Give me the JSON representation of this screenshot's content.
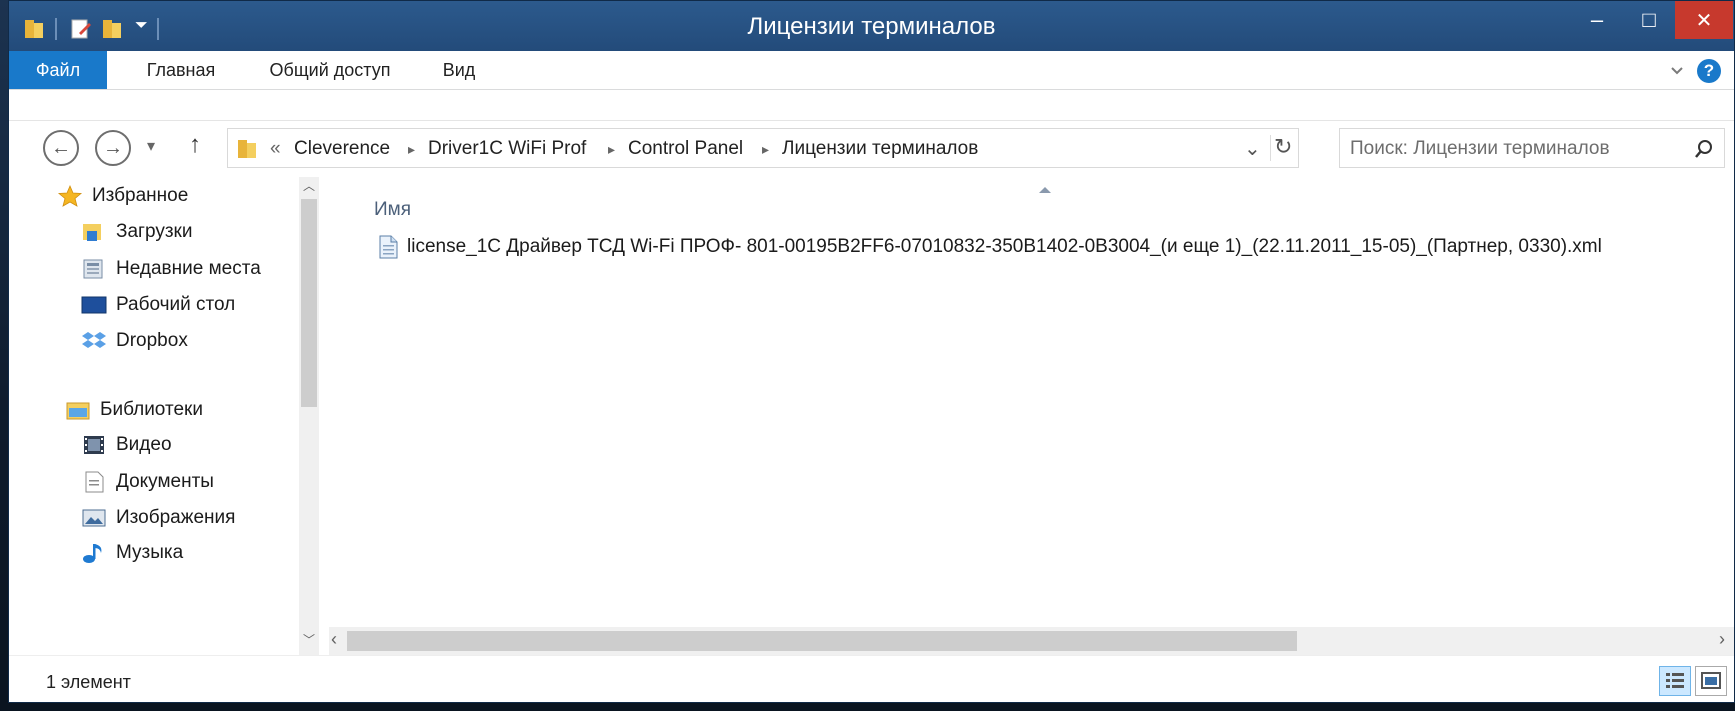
{
  "window": {
    "title": "Лицензии терминалов",
    "controls": {
      "minimize": "–",
      "maximize": "□",
      "close": "✕"
    }
  },
  "ribbon": {
    "tabs": [
      "Файл",
      "Главная",
      "Общий доступ",
      "Вид"
    ],
    "expand_icon": "chevron-down-icon",
    "help_icon": "?"
  },
  "address": {
    "back_icon": "←",
    "forward_icon": "→",
    "recent_icon": "▾",
    "up_icon": "↑",
    "overflow": "«",
    "breadcrumb": [
      "Cleverence",
      "Driver1C WiFi Prof",
      "Control Panel",
      "Лицензии терминалов"
    ],
    "dropdown_icon": "⌄",
    "refresh_icon": "↻"
  },
  "search": {
    "placeholder": "Поиск: Лицензии терминалов"
  },
  "sidebar": {
    "favorites": {
      "label": "Избранное",
      "items": [
        "Загрузки",
        "Недавние места",
        "Рабочий стол",
        "Dropbox"
      ]
    },
    "libraries": {
      "label": "Библиотеки",
      "items": [
        "Видео",
        "Документы",
        "Изображения",
        "Музыка"
      ]
    }
  },
  "content": {
    "column_header": "Имя",
    "files": [
      {
        "name": "license_1C Драйвер ТСД Wi-Fi ПРОФ- 801-00195B2FF6-07010832-350B1402-0B3004_(и еще 1)_(22.11.2011_15-05)_(Партнер, 0330).xml"
      }
    ]
  },
  "status": {
    "count_text": "1 элемент"
  },
  "colors": {
    "file_tab": "#1979ca",
    "titlebar": "#234b7a",
    "close": "#c7392d"
  }
}
